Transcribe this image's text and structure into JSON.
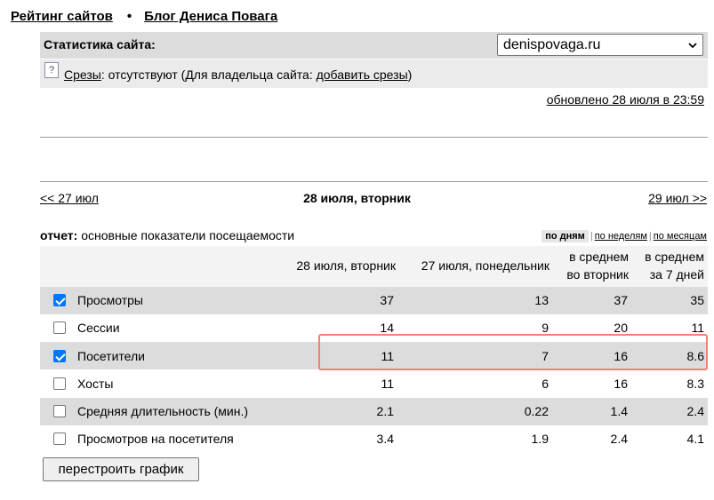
{
  "nav": {
    "ratings": "Рейтинг сайтов",
    "separator": "•",
    "blog": "Блог Дениса Повага"
  },
  "stats": {
    "label": "Статистика сайта:",
    "site": "denispovaga.ru",
    "slices_link": "Срезы",
    "slices_text": ": отсутствуют (Для владельца сайта: ",
    "slices_add": "добавить срезы",
    "slices_close": ")"
  },
  "updated": "обновлено 28 июля в 23:59",
  "date_nav": {
    "prev": "<< 27 июл",
    "current": "28 июля, вторник",
    "next": "29 июл >>"
  },
  "report": {
    "label": "отчет:",
    "text": " основные показатели посещаемости"
  },
  "period": {
    "by_days": "по дням",
    "by_weeks": "по неделям",
    "by_months": "по месяцам",
    "pipe": "|"
  },
  "columns": {
    "c1": "28 июля, вторник",
    "c2": "27 июля, понедельник",
    "c3a": "в среднем",
    "c3b": "во вторник",
    "c4a": "в среднем",
    "c4b": "за 7 дней"
  },
  "rows": [
    {
      "name": "Просмотры",
      "checked": true,
      "v": [
        "37",
        "13",
        "37",
        "35"
      ]
    },
    {
      "name": "Сессии",
      "checked": false,
      "v": [
        "14",
        "9",
        "20",
        "11"
      ]
    },
    {
      "name": "Посетители",
      "checked": true,
      "v": [
        "11",
        "7",
        "16",
        "8.6"
      ]
    },
    {
      "name": "Хосты",
      "checked": false,
      "v": [
        "11",
        "6",
        "16",
        "8.3"
      ]
    },
    {
      "name": "Средняя длительность (мин.)",
      "checked": false,
      "v": [
        "2.1",
        "0.22",
        "1.4",
        "2.4"
      ]
    },
    {
      "name": "Просмотров на посетителя",
      "checked": false,
      "v": [
        "3.4",
        "1.9",
        "2.4",
        "4.1"
      ]
    }
  ],
  "rebuild_button": "перестроить график"
}
